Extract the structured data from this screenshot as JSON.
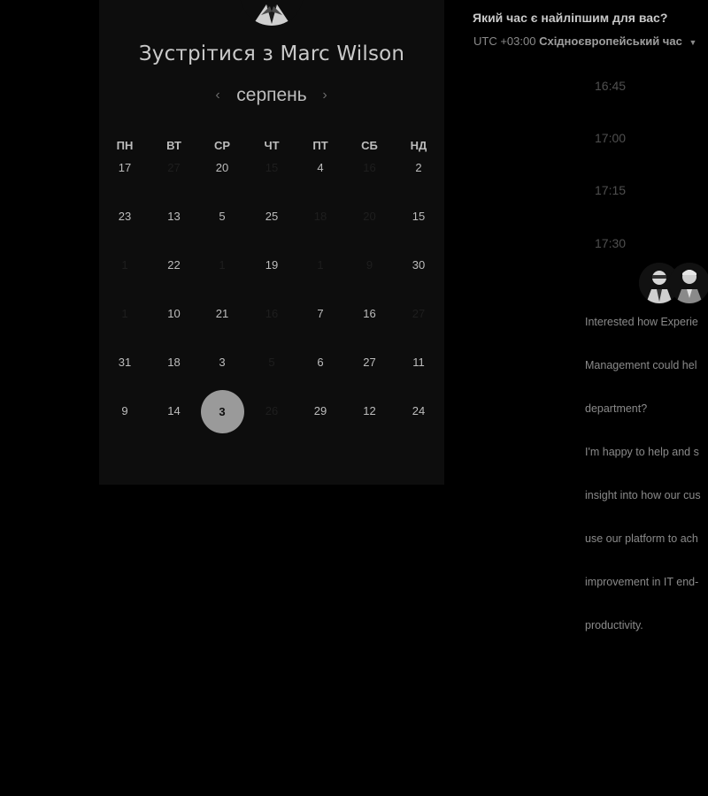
{
  "meeting": {
    "title": "Зустрітися з Marc Wilson",
    "month": "серпень",
    "prev_icon": "chevron-left-icon",
    "next_icon": "chevron-right-icon"
  },
  "calendar": {
    "weekdays": [
      "ПН",
      "ВТ",
      "СР",
      "ЧТ",
      "ПТ",
      "СБ",
      "НД"
    ],
    "weeks": [
      [
        {
          "d": "17",
          "dim": false
        },
        {
          "d": "27",
          "dim": true
        },
        {
          "d": "20",
          "dim": false
        },
        {
          "d": "15",
          "dim": true
        },
        {
          "d": "4",
          "dim": false
        },
        {
          "d": "16",
          "dim": true
        },
        {
          "d": "2",
          "dim": false
        }
      ],
      [
        {
          "d": "23",
          "dim": false
        },
        {
          "d": "13",
          "dim": false
        },
        {
          "d": "5",
          "dim": false
        },
        {
          "d": "25",
          "dim": false
        },
        {
          "d": "18",
          "dim": true
        },
        {
          "d": "20",
          "dim": true
        },
        {
          "d": "15",
          "dim": false
        }
      ],
      [
        {
          "d": "1",
          "dim": true
        },
        {
          "d": "22",
          "dim": false
        },
        {
          "d": "1",
          "dim": true
        },
        {
          "d": "19",
          "dim": false
        },
        {
          "d": "1",
          "dim": true
        },
        {
          "d": "9",
          "dim": true
        },
        {
          "d": "30",
          "dim": false
        }
      ],
      [
        {
          "d": "1",
          "dim": true
        },
        {
          "d": "10",
          "dim": false
        },
        {
          "d": "21",
          "dim": false
        },
        {
          "d": "16",
          "dim": true
        },
        {
          "d": "7",
          "dim": false
        },
        {
          "d": "16",
          "dim": false
        },
        {
          "d": "27",
          "dim": true
        }
      ],
      [
        {
          "d": "31",
          "dim": false
        },
        {
          "d": "18",
          "dim": false
        },
        {
          "d": "3",
          "dim": false
        },
        {
          "d": "5",
          "dim": true
        },
        {
          "d": "6",
          "dim": false
        },
        {
          "d": "27",
          "dim": false
        },
        {
          "d": "11",
          "dim": false
        }
      ],
      [
        {
          "d": "9",
          "dim": false
        },
        {
          "d": "14",
          "dim": false
        },
        {
          "d": "3",
          "dim": false,
          "selected": true
        },
        {
          "d": "26",
          "dim": true
        },
        {
          "d": "29",
          "dim": false
        },
        {
          "d": "12",
          "dim": false
        },
        {
          "d": "24",
          "dim": false
        }
      ]
    ]
  },
  "right": {
    "title": "Який час є найліпшим для вас?",
    "tz_offset": "UTC +03:00",
    "tz_name": "Східноєвропейський час",
    "tz_caret": "caret-down-icon",
    "slots": [
      "16:45",
      "17:00",
      "17:15",
      "17:30"
    ],
    "description": [
      [
        "Interested how Experie",
        "Management could hel",
        "department?"
      ],
      [
        "I'm happy to help and s",
        "insight into how our cus",
        "use our platform to ach",
        "improvement in IT end-",
        "productivity."
      ]
    ]
  },
  "colors": {
    "background": "#000000",
    "card": "#0d0d0d",
    "selected_day": "#9a9a9a"
  }
}
